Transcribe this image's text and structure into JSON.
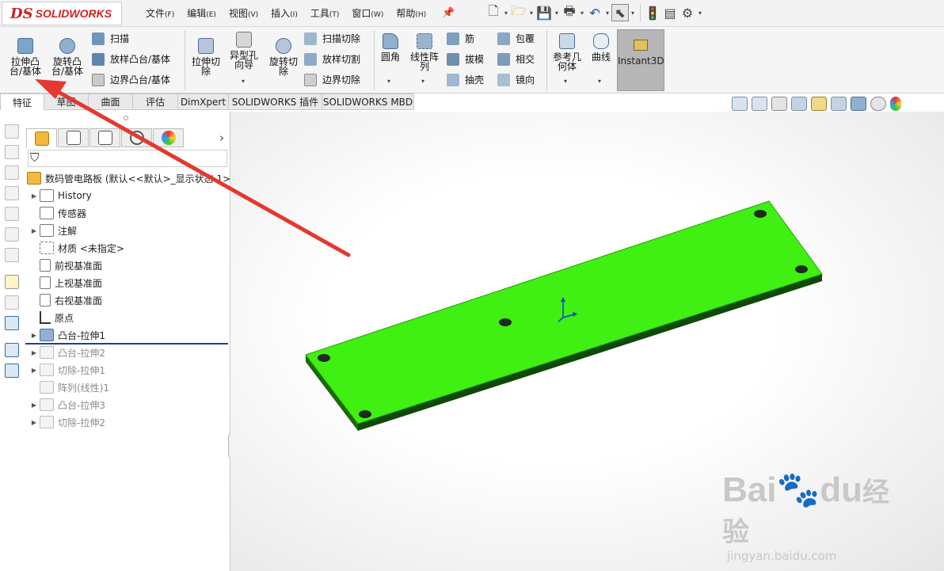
{
  "app": {
    "logo_mark": "DS",
    "logo_name": "SOLIDWORKS"
  },
  "menu": [
    {
      "label": "文件",
      "key": "(F)"
    },
    {
      "label": "编辑",
      "key": "(E)"
    },
    {
      "label": "视图",
      "key": "(V)"
    },
    {
      "label": "插入",
      "key": "(I)"
    },
    {
      "label": "工具",
      "key": "(T)"
    },
    {
      "label": "窗口",
      "key": "(W)"
    },
    {
      "label": "帮助",
      "key": "(H)"
    }
  ],
  "ribbon": {
    "extrude_boss": "拉伸凸\n台/基体",
    "revolve_boss": "旋转凸\n台/基体",
    "sweep": "扫描",
    "loft_boss": "放样凸台/基体",
    "boundary_boss": "边界凸台/基体",
    "extrude_cut": "拉伸切\n除",
    "hole_wizard": "异型孔\n向导",
    "revolve_cut": "旋转切\n除",
    "sweep_cut": "扫描切除",
    "loft_cut": "放样切割",
    "boundary_cut": "边界切除",
    "fillet": "圆角",
    "linear_pattern": "线性阵\n列",
    "rib": "筋",
    "draft": "拔模",
    "shell": "抽壳",
    "wrap": "包覆",
    "intersect": "相交",
    "mirror": "镜向",
    "ref_geometry": "参考几\n何体",
    "curves": "曲线",
    "instant3d": "Instant3D"
  },
  "tabs": [
    "特征",
    "草图",
    "曲面",
    "评估",
    "DimXpert",
    "SOLIDWORKS 插件",
    "SOLIDWORKS MBD"
  ],
  "tree": {
    "root": "数码管电路板 (默认<<默认>_显示状态 1>",
    "items": [
      {
        "label": "History",
        "expandable": true,
        "suppressed": false
      },
      {
        "label": "传感器",
        "expandable": false,
        "suppressed": false
      },
      {
        "label": "注解",
        "expandable": true,
        "suppressed": false
      },
      {
        "label": "材质 <未指定>",
        "expandable": false,
        "suppressed": false
      },
      {
        "label": "前视基准面",
        "expandable": false,
        "suppressed": false
      },
      {
        "label": "上视基准面",
        "expandable": false,
        "suppressed": false
      },
      {
        "label": "右视基准面",
        "expandable": false,
        "suppressed": false
      },
      {
        "label": "原点",
        "expandable": false,
        "suppressed": false
      },
      {
        "label": "凸台-拉伸1",
        "expandable": true,
        "suppressed": false
      },
      {
        "label": "凸台-拉伸2",
        "expandable": true,
        "suppressed": true
      },
      {
        "label": "切除-拉伸1",
        "expandable": true,
        "suppressed": true
      },
      {
        "label": "阵列(线性)1",
        "expandable": false,
        "suppressed": true
      },
      {
        "label": "凸台-拉伸3",
        "expandable": true,
        "suppressed": true
      },
      {
        "label": "切除-拉伸2",
        "expandable": true,
        "suppressed": true
      }
    ]
  },
  "colors": {
    "part_green": "#3ff012",
    "arrow_red": "#e5382e",
    "logo_red": "#d42020",
    "rollback": "#1d3f8f"
  },
  "watermark": {
    "brand": "Bai",
    "brand_suffix": "du",
    "cn": "经验",
    "url": "jingyan.baidu.com"
  }
}
